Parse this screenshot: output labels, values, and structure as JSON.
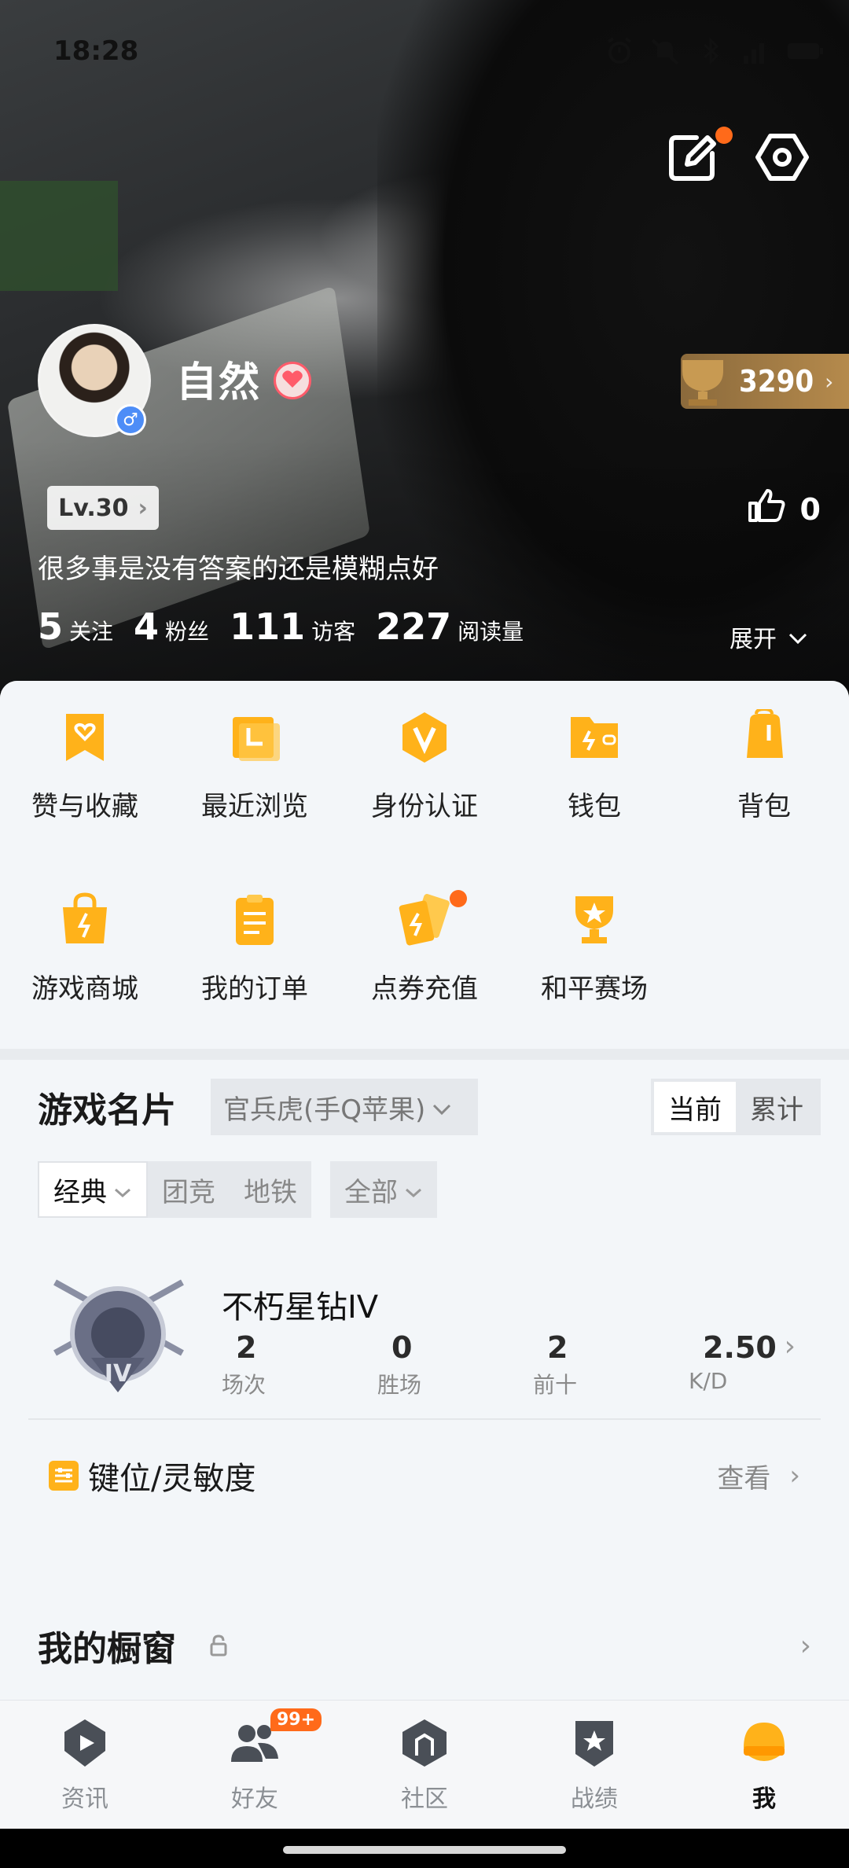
{
  "status_bar": {
    "time": "18:28"
  },
  "profile": {
    "nickname": "自然",
    "gender_symbol": "♂",
    "level": "Lv.30",
    "bio": "很多事是没有答案的还是模糊点好",
    "trophy_score": "3290",
    "likes": "0",
    "expand_label": "展开",
    "stats": [
      {
        "value": "5",
        "label": "关注"
      },
      {
        "value": "4",
        "label": "粉丝"
      },
      {
        "value": "111",
        "label": "访客"
      },
      {
        "value": "227",
        "label": "阅读量"
      }
    ]
  },
  "menu": [
    {
      "label": "赞与收藏",
      "icon": "bookmark-heart-icon"
    },
    {
      "label": "最近浏览",
      "icon": "recent-folder-icon"
    },
    {
      "label": "身份认证",
      "icon": "verified-v-icon"
    },
    {
      "label": "钱包",
      "icon": "wallet-icon"
    },
    {
      "label": "背包",
      "icon": "backpack-icon"
    },
    {
      "label": "游戏商城",
      "icon": "shopping-bag-icon"
    },
    {
      "label": "我的订单",
      "icon": "clipboard-icon"
    },
    {
      "label": "点券充值",
      "icon": "voucher-cards-icon",
      "has_dot": true
    },
    {
      "label": "和平赛场",
      "icon": "trophy-star-icon"
    }
  ],
  "game_card": {
    "title": "游戏名片",
    "server": "官兵虎(手Q苹果)",
    "toggle": [
      "当前",
      "累计"
    ],
    "mode_filters": [
      "经典",
      "团竞",
      "地铁"
    ],
    "scope_filter": "全部",
    "rank": {
      "name": "不朽星钻IV",
      "stats": [
        {
          "value": "2",
          "label": "场次"
        },
        {
          "value": "0",
          "label": "胜场"
        },
        {
          "value": "2",
          "label": "前十"
        },
        {
          "value": "2.50",
          "label": "K/D"
        }
      ]
    },
    "keybind": {
      "label": "键位/灵敏度",
      "action": "查看"
    }
  },
  "showcase": {
    "title": "我的橱窗"
  },
  "nav": [
    {
      "label": "资讯",
      "icon": "news-play-icon"
    },
    {
      "label": "好友",
      "icon": "friends-icon",
      "badge": "99+"
    },
    {
      "label": "社区",
      "icon": "community-icon"
    },
    {
      "label": "战绩",
      "icon": "record-badge-icon"
    },
    {
      "label": "我",
      "icon": "me-helmet-icon",
      "active": true
    }
  ],
  "colors": {
    "accent": "#ffb21a",
    "dot": "#ff6a1a",
    "trophy": "#b58a4c"
  }
}
